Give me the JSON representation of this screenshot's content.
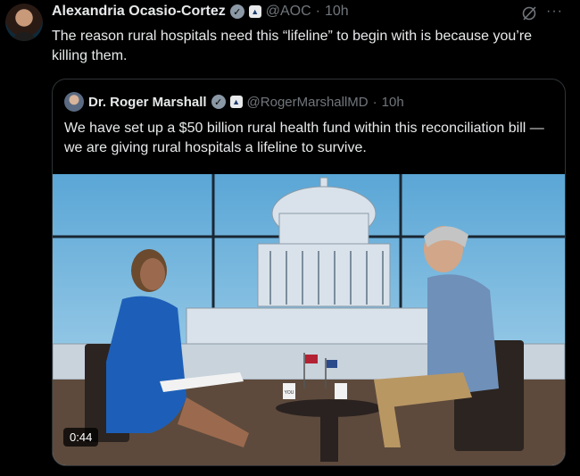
{
  "tweet": {
    "author_name": "Alexandria Ocasio-Cortez",
    "verified_icon": "verified-badge-icon",
    "affiliation_icon": "government-affiliation-icon",
    "handle": "@AOC",
    "separator": "·",
    "time": "10h",
    "text": "The reason rural hospitals need this “lifeline” to begin with is because you’re killing them.",
    "actions": {
      "grok_icon": "grok-icon",
      "more_icon": "more-icon",
      "more_label": "···"
    }
  },
  "quoted": {
    "author_name": "Dr. Roger Marshall",
    "handle": "@RogerMarshallMD",
    "separator": "·",
    "time": "10h",
    "text": "We have set up a $50 billion rural health fund within this reconciliation bill — we are giving rural hospitals a lifeline to survive.",
    "video": {
      "duration": "0:44",
      "mug_label": "YOU"
    }
  },
  "colors": {
    "background": "#000000",
    "text": "#e7e9ea",
    "secondary": "#71767b",
    "border": "#2f3336"
  }
}
